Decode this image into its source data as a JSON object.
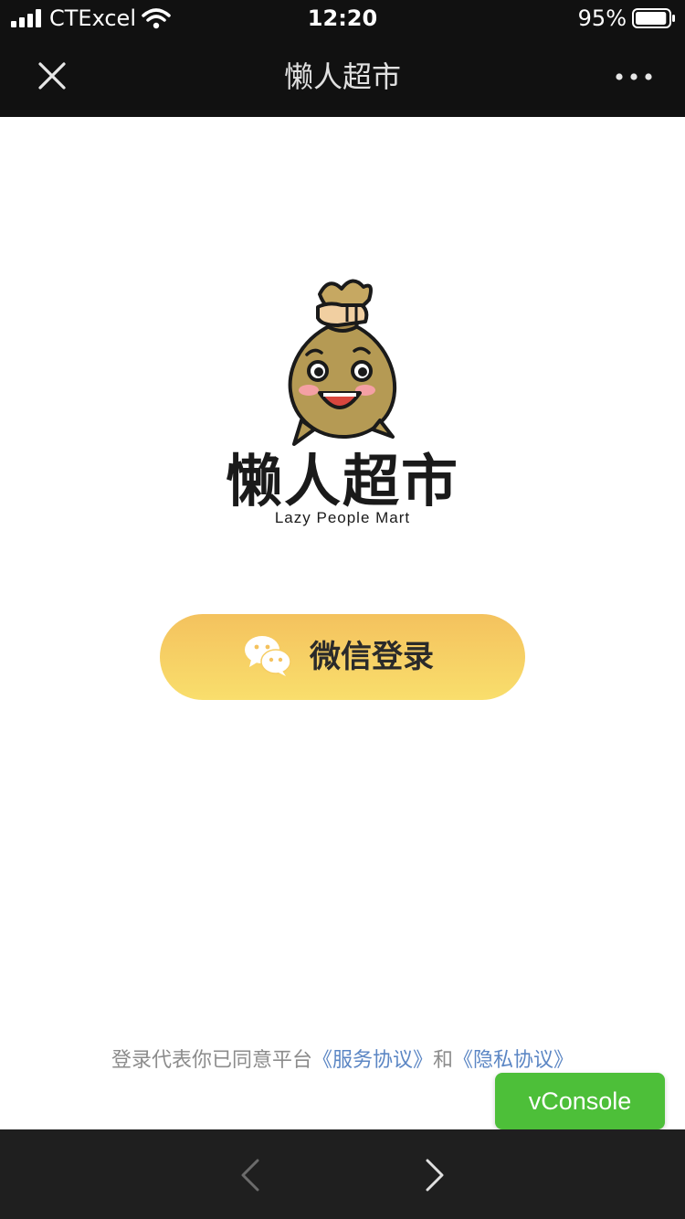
{
  "status_bar": {
    "carrier": "CTExcel",
    "time": "12:20",
    "battery": "95%",
    "battery_level": 0.95,
    "icons": [
      "signal-icon",
      "wifi-icon",
      "battery-icon"
    ]
  },
  "nav": {
    "title": "懒人超市",
    "icons": [
      "close-icon",
      "more-icon"
    ]
  },
  "logo": {
    "title_cn": "懒人超市",
    "title_en": "Lazy People Mart",
    "icon": "mascot-bag-icon"
  },
  "login": {
    "label": "微信登录",
    "icon": "wechat-icon"
  },
  "agreement": {
    "prefix": "登录代表你已同意平台",
    "service_link": "《服务协议》",
    "conjunction": "和",
    "privacy_link": "《隐私协议》"
  },
  "vconsole": {
    "label": "vConsole"
  },
  "toolbar": {
    "icons": [
      "back-arrow-icon",
      "forward-arrow-icon"
    ]
  },
  "colors": {
    "bar_background": "#111111",
    "button_gradient_top": "#f4c25e",
    "button_gradient_bottom": "#f9de6c",
    "link": "#5b86c4",
    "vconsole_green": "#4dbf39"
  }
}
